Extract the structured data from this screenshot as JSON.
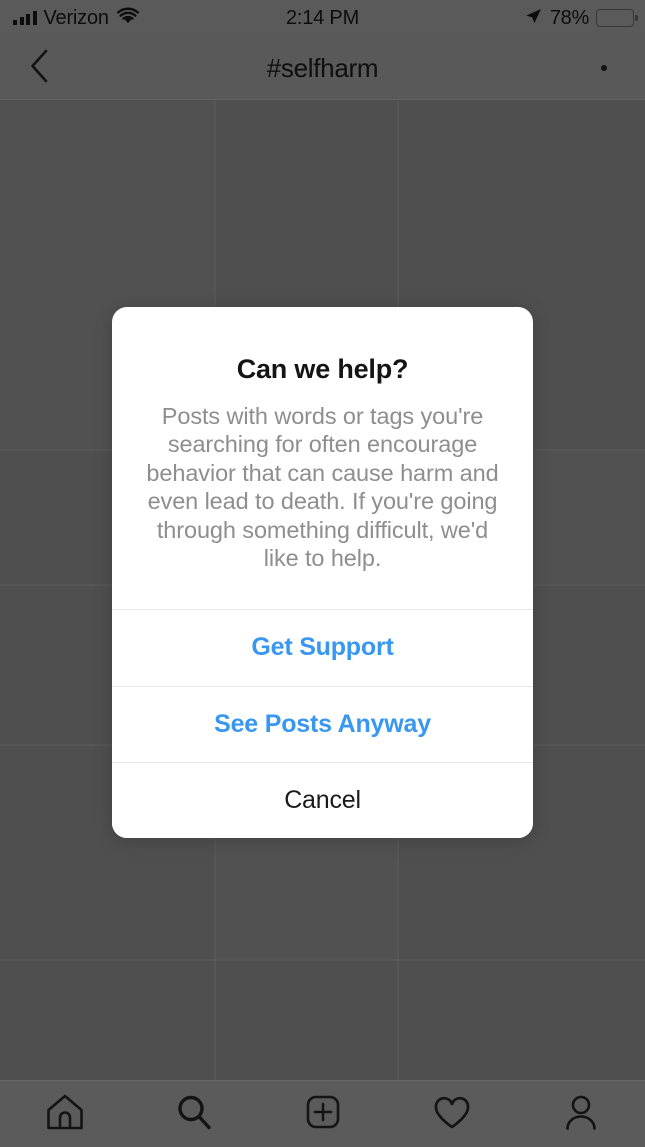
{
  "status_bar": {
    "carrier": "Verizon",
    "wifi_icon": "wifi-icon",
    "signal_icon": "cellular-signal-icon",
    "time": "2:14 PM",
    "location_icon": "location-arrow-icon",
    "battery_percent": "78%",
    "battery_level": 78,
    "battery_icon": "battery-icon"
  },
  "nav_header": {
    "back_icon": "chevron-left-icon",
    "title": "#selfharm",
    "more_icon": "ellipsis-icon"
  },
  "dialog": {
    "title": "Can we help?",
    "message": "Posts with words or tags you're searching for often encourage behavior that can cause harm and even lead to death. If you're going through something difficult, we'd like to help.",
    "buttons": [
      {
        "label": "Get Support",
        "style": "primary"
      },
      {
        "label": "See Posts Anyway",
        "style": "secondary"
      },
      {
        "label": "Cancel",
        "style": "cancel"
      }
    ]
  },
  "tab_bar": {
    "items": [
      {
        "name": "tab-home",
        "icon": "home-icon"
      },
      {
        "name": "tab-search",
        "icon": "search-icon"
      },
      {
        "name": "tab-add-post",
        "icon": "plus-square-icon"
      },
      {
        "name": "tab-activity",
        "icon": "heart-icon"
      },
      {
        "name": "tab-profile",
        "icon": "person-icon"
      }
    ]
  },
  "colors": {
    "accent_blue": "#3897F0",
    "dimmed_backdrop": "#4F4F4F",
    "header_gray": "#595959",
    "tabbar_gray": "#5B5B5B",
    "dialog_white": "#FFFFFF",
    "message_gray": "#8E8E8E",
    "divider_gray": "#E6E6E6"
  }
}
